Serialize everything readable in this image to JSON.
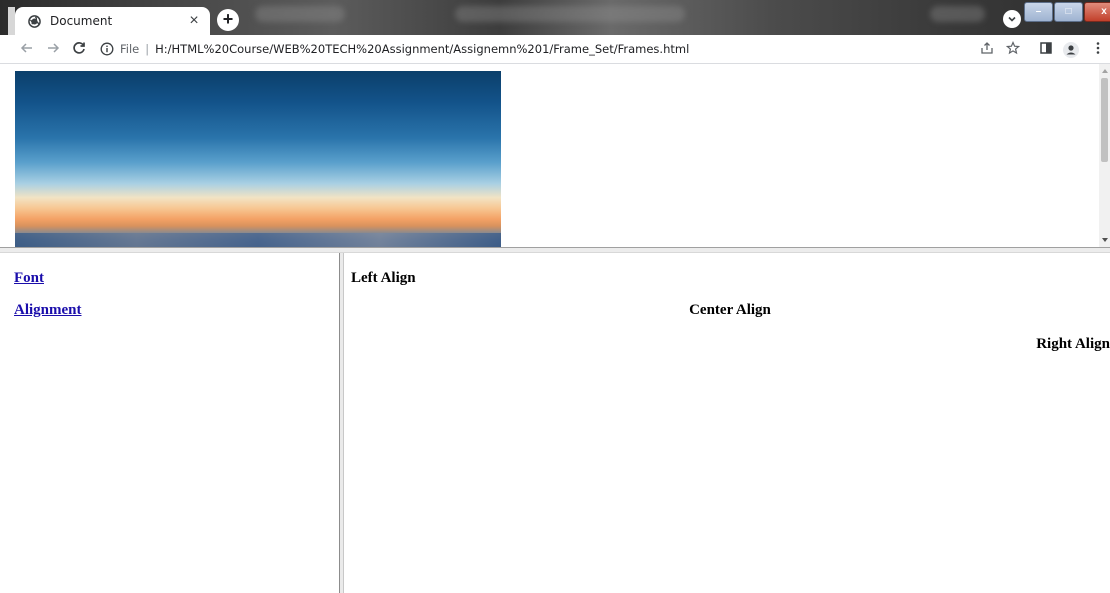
{
  "browser": {
    "tab_title": "Document",
    "tab_close": "×",
    "new_tab": "+",
    "address": {
      "label": "File",
      "separator": "|",
      "url": "H:/HTML%20Course/WEB%20TECH%20Assignment/Assignemn%201/Frame_Set/Frames.html"
    }
  },
  "left_frame": {
    "links": [
      {
        "label": "Font"
      },
      {
        "label": "Alignment"
      }
    ]
  },
  "right_frame": {
    "left_align": "Left Align",
    "center_align": "Center Align",
    "right_align": "Right Align"
  },
  "colors": {
    "link": "#1a0dab",
    "text": "#000000"
  },
  "icons": {
    "favicon": "globe-icon",
    "back": "back-arrow-icon",
    "forward": "forward-arrow-icon",
    "reload": "reload-icon",
    "info": "info-icon",
    "share": "share-icon",
    "bookmark": "star-icon",
    "side_panel": "side-panel-icon",
    "profile": "profile-icon",
    "menu": "kebab-menu-icon",
    "tab_search": "chevron-down-icon"
  }
}
